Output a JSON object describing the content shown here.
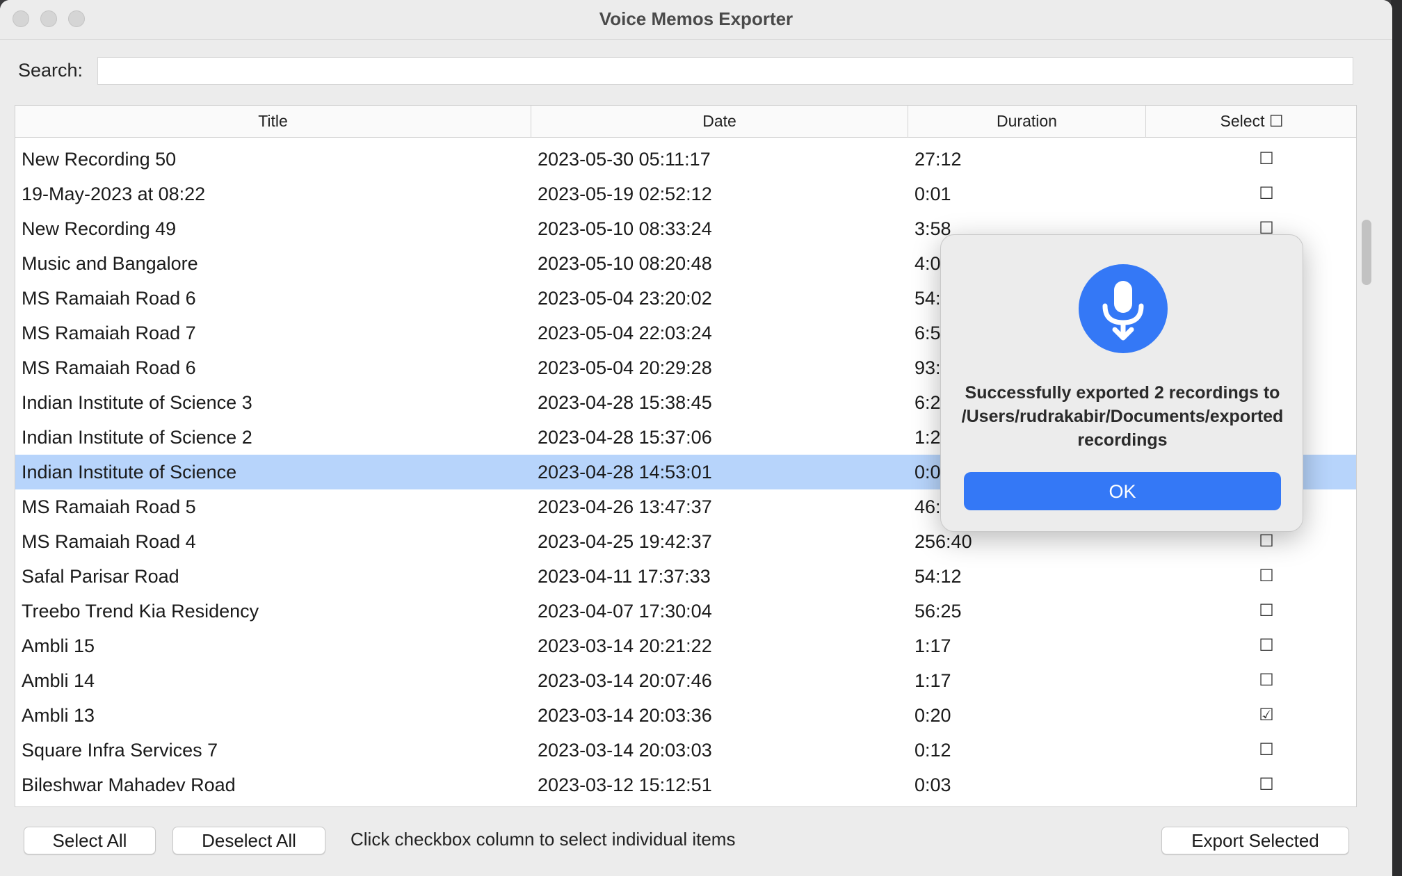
{
  "window": {
    "title": "Voice Memos Exporter"
  },
  "search": {
    "label": "Search:",
    "value": "",
    "placeholder": ""
  },
  "table": {
    "columns": {
      "title": "Title",
      "date": "Date",
      "duration": "Duration",
      "select": "Select ☐"
    },
    "rows": [
      {
        "title": "New Recording 50",
        "date": "2023-05-30 05:11:17",
        "duration": "27:12",
        "select": "☐"
      },
      {
        "title": "19-May-2023 at 08:22",
        "date": "2023-05-19 02:52:12",
        "duration": "0:01",
        "select": "☐"
      },
      {
        "title": "New Recording 49",
        "date": "2023-05-10 08:33:24",
        "duration": "3:58",
        "select": "☐"
      },
      {
        "title": "Music and Bangalore",
        "date": "2023-05-10 08:20:48",
        "duration": "4:0",
        "select": ""
      },
      {
        "title": "MS Ramaiah Road 6",
        "date": "2023-05-04 23:20:02",
        "duration": "54:",
        "select": ""
      },
      {
        "title": "MS Ramaiah Road 7",
        "date": "2023-05-04 22:03:24",
        "duration": "6:5",
        "select": ""
      },
      {
        "title": "MS Ramaiah Road 6",
        "date": "2023-05-04 20:29:28",
        "duration": "93:",
        "select": ""
      },
      {
        "title": "Indian Institute of Science 3",
        "date": "2023-04-28 15:38:45",
        "duration": "6:2",
        "select": ""
      },
      {
        "title": "Indian Institute of Science 2",
        "date": "2023-04-28 15:37:06",
        "duration": "1:2",
        "select": ""
      },
      {
        "title": "Indian Institute of Science",
        "date": "2023-04-28 14:53:01",
        "duration": "0:0",
        "select": "",
        "selected": true
      },
      {
        "title": "MS Ramaiah Road 5",
        "date": "2023-04-26 13:47:37",
        "duration": "46:",
        "select": ""
      },
      {
        "title": "MS Ramaiah Road 4",
        "date": "2023-04-25 19:42:37",
        "duration": "256:40",
        "select": "☐"
      },
      {
        "title": "Safal Parisar Road",
        "date": "2023-04-11 17:37:33",
        "duration": "54:12",
        "select": "☐"
      },
      {
        "title": "Treebo Trend Kia Residency",
        "date": "2023-04-07 17:30:04",
        "duration": "56:25",
        "select": "☐"
      },
      {
        "title": "Ambli 15",
        "date": "2023-03-14 20:21:22",
        "duration": "1:17",
        "select": "☐"
      },
      {
        "title": "Ambli 14",
        "date": "2023-03-14 20:07:46",
        "duration": "1:17",
        "select": "☐"
      },
      {
        "title": "Ambli 13",
        "date": "2023-03-14 20:03:36",
        "duration": "0:20",
        "select": "☑"
      },
      {
        "title": "Square Infra Services 7",
        "date": "2023-03-14 20:03:03",
        "duration": "0:12",
        "select": "☐"
      },
      {
        "title": "Bileshwar Mahadev Road",
        "date": "2023-03-12 15:12:51",
        "duration": "0:03",
        "select": "☐"
      }
    ]
  },
  "footer": {
    "select_all": "Select All",
    "deselect_all": "Deselect All",
    "hint": "Click checkbox column to select individual items",
    "export": "Export Selected"
  },
  "dialog": {
    "icon": "voice-memo-icon",
    "message": "Successfully exported 2 recordings to /Users/rudrakabir/Documents/exported recordings",
    "ok_label": "OK"
  },
  "colors": {
    "accent": "#3478f6",
    "row_highlight": "#b7d4fb"
  }
}
